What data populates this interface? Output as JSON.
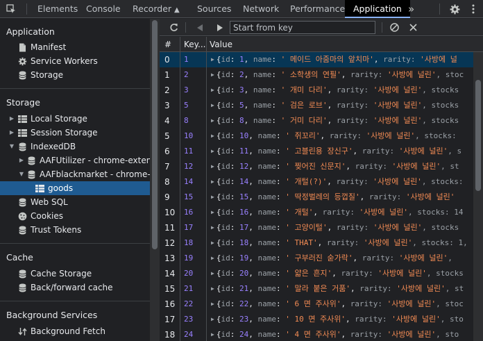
{
  "tabbar": {
    "tabs": [
      "Elements",
      "Console",
      "Recorder",
      "Sources",
      "Network",
      "Performance",
      "Application"
    ],
    "active": "Application",
    "more": "»"
  },
  "sidebar": {
    "sections": [
      {
        "title": "Application",
        "items": [
          "Manifest",
          "Service Workers",
          "Storage"
        ]
      },
      {
        "title": "Storage",
        "items": [
          "Local Storage",
          "Session Storage",
          "IndexedDB",
          "AAFUtilizer - chrome-extension",
          "AAFblackmarket - chrome-exte",
          "goods",
          "Web SQL",
          "Cookies",
          "Trust Tokens"
        ]
      },
      {
        "title": "Cache",
        "items": [
          "Cache Storage",
          "Back/forward cache"
        ]
      },
      {
        "title": "Background Services",
        "items": [
          "Background Fetch"
        ]
      }
    ],
    "selected": "goods"
  },
  "toolbar": {
    "start_key_placeholder": "Start from key"
  },
  "table": {
    "headers": [
      "#",
      "Key...",
      "Value"
    ],
    "rows": [
      {
        "num": "0",
        "key": "1",
        "id": "1",
        "name": " 메이드 아줌마의 앞치마",
        "tail": ", rarity: '사방에 널"
      },
      {
        "num": "1",
        "key": "2",
        "id": "2",
        "name": " 소학생의 연필",
        "tail": ", rarity: '사방에 널린', stoc"
      },
      {
        "num": "2",
        "key": "3",
        "id": "3",
        "name": " 개미 다리",
        "tail": ", rarity: '사방에 널린', stocks"
      },
      {
        "num": "3",
        "key": "5",
        "id": "5",
        "name": " 검은 로브",
        "tail": ", rarity: '사방에 널린', stocks"
      },
      {
        "num": "4",
        "key": "8",
        "id": "8",
        "name": " 거미 다리",
        "tail": ", rarity: '사방에 널린', stocks"
      },
      {
        "num": "5",
        "key": "10",
        "id": "10",
        "name": " 쥐꼬리",
        "tail": ", rarity: '사방에 널린', stocks: "
      },
      {
        "num": "6",
        "key": "11",
        "id": "11",
        "name": " 고블린용 장신구",
        "tail": ", rarity: '사방에 널린', s"
      },
      {
        "num": "7",
        "key": "12",
        "id": "12",
        "name": " 찢어진 신문지",
        "tail": ", rarity: '사방에 널린', st"
      },
      {
        "num": "8",
        "key": "14",
        "id": "14",
        "name": " 개털(?)",
        "tail": ", rarity: '사방에 널린', stocks:"
      },
      {
        "num": "9",
        "key": "15",
        "id": "15",
        "name": " 딱정벌레의 등껍질",
        "tail": ", rarity: '사방에 널린'"
      },
      {
        "num": "10",
        "key": "16",
        "id": "16",
        "name": " 개털",
        "tail": ", rarity: '사방에 널린', stocks: 14"
      },
      {
        "num": "11",
        "key": "17",
        "id": "17",
        "name": " 고양이털",
        "tail": ", rarity: '사방에 널린', stocks"
      },
      {
        "num": "12",
        "key": "18",
        "id": "18",
        "name": " THAT",
        "tail": ", rarity: '사방에 널린', stocks: 1,"
      },
      {
        "num": "13",
        "key": "19",
        "id": "19",
        "name": " 구부러진 숟가락",
        "tail": ", rarity: '사방에 널린', "
      },
      {
        "num": "14",
        "key": "20",
        "id": "20",
        "name": " 얇은 흔지",
        "tail": ", rarity: '사방에 널린', stocks"
      },
      {
        "num": "15",
        "key": "21",
        "id": "21",
        "name": " 말라 붙은 거품",
        "tail": ", rarity: '사방에 널린', st"
      },
      {
        "num": "16",
        "key": "22",
        "id": "22",
        "name": " 6 면 주사위",
        "tail": ", rarity: '사방에 널린', stoc"
      },
      {
        "num": "17",
        "key": "23",
        "id": "23",
        "name": " 10 면 주사위",
        "tail": ", rarity: '사방에 널린', sto"
      },
      {
        "num": "18",
        "key": "24",
        "id": "24",
        "name": " 4 면 주사위",
        "tail": ", rarity: '사방에 널린', sto"
      }
    ]
  },
  "colors": {
    "accent": "#8ab4f8",
    "selected_sidebar": "#1f5b91",
    "selected_row": "#073655",
    "key_purple": "#9980ff",
    "string_orange": "#f28b54"
  }
}
